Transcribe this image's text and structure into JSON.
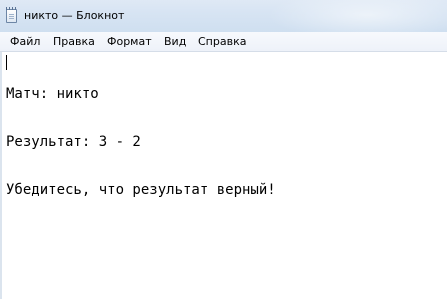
{
  "window": {
    "title": "никто — Блокнот"
  },
  "menu": {
    "items": [
      "Файл",
      "Правка",
      "Формат",
      "Вид",
      "Справка"
    ]
  },
  "editor": {
    "lines": [
      "Матч: никто",
      "Результат: 3 - 2",
      "Убедитесь, что результат верный!"
    ]
  },
  "icons": {
    "app": "notepad-icon"
  }
}
